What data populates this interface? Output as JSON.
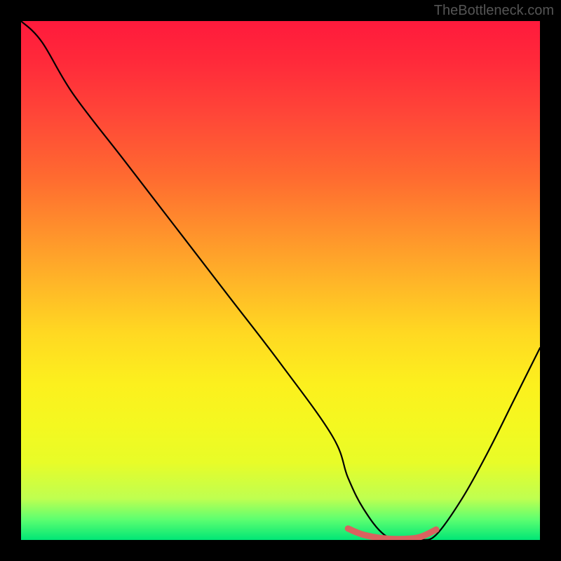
{
  "watermark": "TheBottleneck.com",
  "chart_data": {
    "type": "line",
    "title": "",
    "xlabel": "",
    "ylabel": "",
    "xlim": [
      0,
      100
    ],
    "ylim": [
      0,
      100
    ],
    "series": [
      {
        "name": "bottleneck-curve",
        "x": [
          0,
          4,
          10,
          20,
          30,
          40,
          50,
          60,
          63,
          66,
          70,
          74,
          77,
          80,
          85,
          90,
          95,
          100
        ],
        "values": [
          100,
          96,
          86,
          73,
          60,
          47,
          34,
          20,
          12,
          6,
          1,
          0,
          0,
          1,
          8,
          17,
          27,
          37
        ]
      },
      {
        "name": "highlighted-minimum",
        "x": [
          63,
          66,
          70,
          74,
          77,
          80
        ],
        "values": [
          2.2,
          1.0,
          0.3,
          0.2,
          0.6,
          2.0
        ]
      }
    ],
    "gradient_stops": [
      {
        "pos": 0,
        "color": "#ff1a3c"
      },
      {
        "pos": 50,
        "color": "#ffb428"
      },
      {
        "pos": 78,
        "color": "#f4f820"
      },
      {
        "pos": 100,
        "color": "#00e676"
      }
    ],
    "note": "Axes are unlabeled in the source image; x and y treated as 0–100 percent of plot area. The main black curve descends steeply from top-left, reaches a flat minimum around x≈70–78, then rises toward the right. The pink/red segment marks the flat minimum region."
  }
}
